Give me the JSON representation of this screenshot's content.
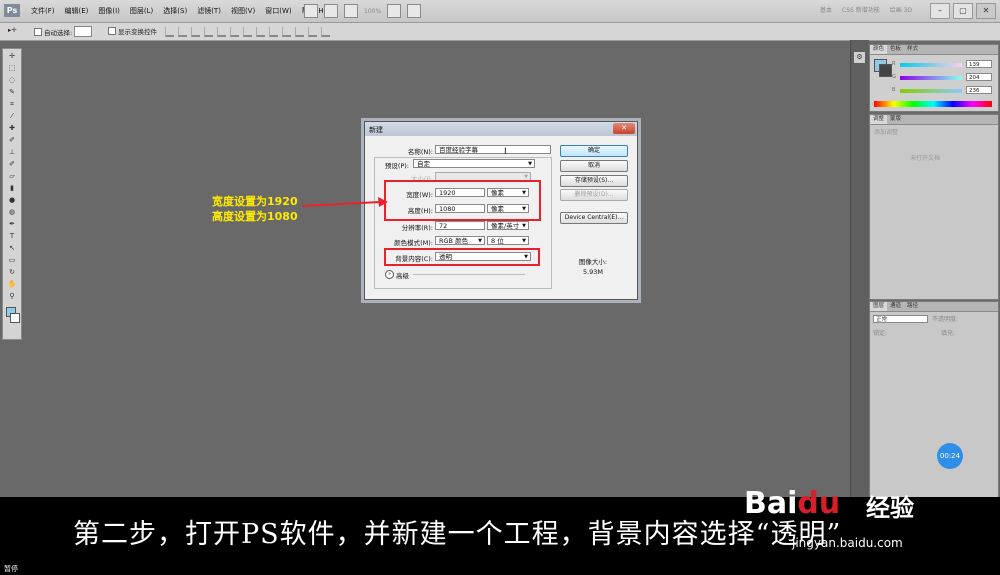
{
  "app": {
    "logo": "Ps",
    "menu": [
      "文件(F)",
      "编辑(E)",
      "图像(I)",
      "图层(L)",
      "选择(S)",
      "滤镜(T)",
      "视图(V)",
      "窗口(W)",
      "帮助(H)"
    ],
    "zoom": "100%",
    "workspaces": [
      "基本",
      "CSS 新增功能",
      "绘画 3D"
    ],
    "window_buttons": [
      "–",
      "▢",
      "✕"
    ]
  },
  "options_bar": {
    "auto_select_label": "自动选择:",
    "show_transform_label": "显示变换控件"
  },
  "panels": {
    "color_tabs": [
      "颜色",
      "色板",
      "样式"
    ],
    "rgb_values": [
      "139",
      "204",
      "236"
    ],
    "rgb_labels": [
      "R",
      "G",
      "B"
    ],
    "adjust_tabs": [
      "调整",
      "蒙版"
    ],
    "adjust_add": "添加调整",
    "adjust_empty": "未打开文档",
    "layers_tabs": [
      "图层",
      "通道",
      "路径"
    ],
    "blend_mode": "正常",
    "opacity_label": "不透明度:",
    "lock_label": "锁定:",
    "fill_label": "填充:",
    "timer": "00:24",
    "colors": {
      "fg": "#8ecae6"
    }
  },
  "dialog": {
    "title": "新建",
    "name_label": "名称(N):",
    "name_value": "百度经验字幕",
    "preset_label": "预设(P):",
    "preset_value": "自定",
    "size_label": "大小(I):",
    "width_label": "宽度(W):",
    "width_value": "1920",
    "width_unit": "像素",
    "height_label": "高度(H):",
    "height_value": "1080",
    "height_unit": "像素",
    "resolution_label": "分辨率(R):",
    "resolution_value": "72",
    "resolution_unit": "像素/英寸",
    "color_mode_label": "颜色模式(M):",
    "color_mode_value": "RGB 颜色",
    "bit_depth": "8 位",
    "bg_label": "背景内容(C):",
    "bg_value": "透明",
    "advanced_label": "高级",
    "buttons": {
      "ok": "确定",
      "cancel": "取消",
      "save_preset": "存储预设(S)...",
      "delete_preset": "删除预设(D)...",
      "device_central": "Device Central(E)..."
    },
    "image_size_label": "图像大小:",
    "image_size_value": "5.93M"
  },
  "annotation": {
    "line1": "宽度设置为1920",
    "line2": "高度设置为1080",
    "colors": {
      "box": "#e8212f",
      "text": "#ffea00"
    }
  },
  "subtitle": "第二步，打开PS软件，并新建一个工程，背景内容选择“透明”",
  "watermark": {
    "brand_a": "Bai",
    "brand_b": "du",
    "experience": "经验",
    "url": "jingyan.baidu.com"
  },
  "status": "暂停"
}
